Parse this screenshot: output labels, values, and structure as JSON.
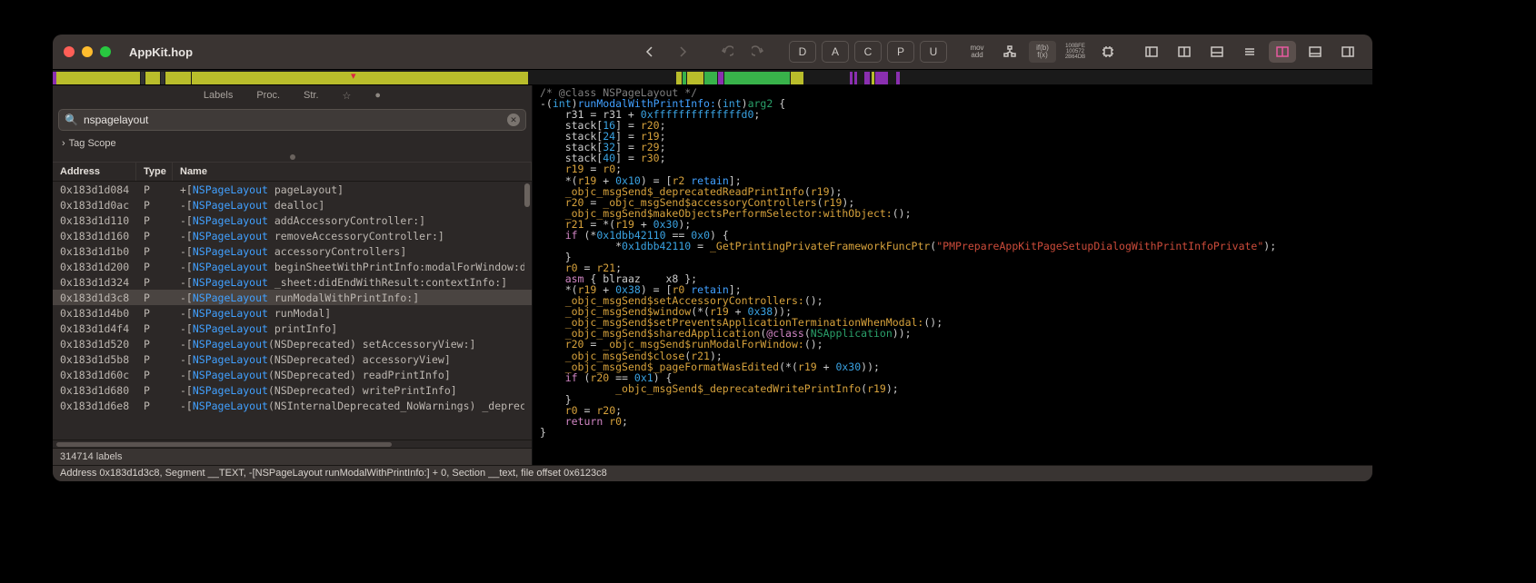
{
  "window": {
    "title": "AppKit.hop"
  },
  "toolbar": {
    "back": "‹",
    "fwd": "›",
    "mode_buttons": [
      "D",
      "A",
      "C",
      "P",
      "U"
    ],
    "mov_add": "mov\nadd",
    "ifb_fx": "if(b)\nf(x)",
    "hex": "100BFE\n100572\n2B64DB"
  },
  "subtabs": {
    "labels": "Labels",
    "proc": "Proc.",
    "str": "Str."
  },
  "search": {
    "value": "nspagelayout",
    "placeholder": ""
  },
  "tagscope": {
    "label": "Tag Scope"
  },
  "table": {
    "headers": {
      "address": "Address",
      "type": "Type",
      "name": "Name"
    },
    "rows": [
      {
        "addr": "0x183d1d084",
        "type": "P",
        "prefix": "+",
        "cls": "NSPageLayout",
        "sel": " pageLayout]",
        "selected": false
      },
      {
        "addr": "0x183d1d0ac",
        "type": "P",
        "prefix": "-",
        "cls": "NSPageLayout",
        "sel": " dealloc]",
        "selected": false
      },
      {
        "addr": "0x183d1d110",
        "type": "P",
        "prefix": "-",
        "cls": "NSPageLayout",
        "sel": " addAccessoryController:]",
        "selected": false
      },
      {
        "addr": "0x183d1d160",
        "type": "P",
        "prefix": "-",
        "cls": "NSPageLayout",
        "sel": " removeAccessoryController:]",
        "selected": false
      },
      {
        "addr": "0x183d1d1b0",
        "type": "P",
        "prefix": "-",
        "cls": "NSPageLayout",
        "sel": " accessoryControllers]",
        "selected": false
      },
      {
        "addr": "0x183d1d200",
        "type": "P",
        "prefix": "-",
        "cls": "NSPageLayout",
        "sel": " beginSheetWithPrintInfo:modalForWindow:delegate:d",
        "selected": false
      },
      {
        "addr": "0x183d1d324",
        "type": "P",
        "prefix": "-",
        "cls": "NSPageLayout",
        "sel": " _sheet:didEndWithResult:contextInfo:]",
        "selected": false
      },
      {
        "addr": "0x183d1d3c8",
        "type": "P",
        "prefix": "-",
        "cls": "NSPageLayout",
        "sel": " runModalWithPrintInfo:]",
        "selected": true
      },
      {
        "addr": "0x183d1d4b0",
        "type": "P",
        "prefix": "-",
        "cls": "NSPageLayout",
        "sel": " runModal]",
        "selected": false
      },
      {
        "addr": "0x183d1d4f4",
        "type": "P",
        "prefix": "-",
        "cls": "NSPageLayout",
        "sel": " printInfo]",
        "selected": false
      },
      {
        "addr": "0x183d1d520",
        "type": "P",
        "prefix": "-",
        "cls": "NSPageLayout",
        "sel": "(NSDeprecated) setAccessoryView:]",
        "selected": false
      },
      {
        "addr": "0x183d1d5b8",
        "type": "P",
        "prefix": "-",
        "cls": "NSPageLayout",
        "sel": "(NSDeprecated) accessoryView]",
        "selected": false
      },
      {
        "addr": "0x183d1d60c",
        "type": "P",
        "prefix": "-",
        "cls": "NSPageLayout",
        "sel": "(NSDeprecated) readPrintInfo]",
        "selected": false
      },
      {
        "addr": "0x183d1d680",
        "type": "P",
        "prefix": "-",
        "cls": "NSPageLayout",
        "sel": "(NSDeprecated) writePrintInfo]",
        "selected": false
      },
      {
        "addr": "0x183d1d6e8",
        "type": "P",
        "prefix": "-",
        "cls": "NSPageLayout",
        "sel": "(NSInternalDeprecated_NoWarnings) _deprecatedReadP",
        "selected": false
      }
    ]
  },
  "label_count": "314714 labels",
  "code": {
    "l00": "/* @class NSPageLayout */",
    "l01a": "-(",
    "l01b": "int",
    "l01c": ")",
    "l01d": "runModalWithPrintInfo:",
    "l01e": "(",
    "l01f": "int",
    "l01g": ")",
    "l01h": "arg2",
    "l01i": " {",
    "l02a": "    r31 = r31 + ",
    "l02b": "0xffffffffffffffd0",
    "l02c": ";",
    "l03a": "    stack[",
    "l03b": "16",
    "l03c": "] = ",
    "l03d": "r20",
    "l03e": ";",
    "l04a": "    stack[",
    "l04b": "24",
    "l04c": "] = ",
    "l04d": "r19",
    "l04e": ";",
    "l05a": "    stack[",
    "l05b": "32",
    "l05c": "] = ",
    "l05d": "r29",
    "l05e": ";",
    "l06a": "    stack[",
    "l06b": "40",
    "l06c": "] = ",
    "l06d": "r30",
    "l06e": ";",
    "l07a": "    ",
    "l07b": "r19",
    "l07c": " = ",
    "l07d": "r0",
    "l07e": ";",
    "l08a": "    *(",
    "l08b": "r19",
    "l08c": " + ",
    "l08d": "0x10",
    "l08e": ") = [",
    "l08f": "r2",
    "l08g": " ",
    "l08h": "retain",
    "l08i": "];",
    "l09a": "    ",
    "l09b": "_objc_msgSend$_deprecatedReadPrintInfo",
    "l09c": "(",
    "l09d": "r19",
    "l09e": ");",
    "l10a": "    ",
    "l10b": "r20",
    "l10c": " = ",
    "l10d": "_objc_msgSend$accessoryControllers",
    "l10e": "(",
    "l10f": "r19",
    "l10g": ");",
    "l11a": "    ",
    "l11b": "_objc_msgSend$makeObjectsPerformSelector:withObject:",
    "l11c": "();",
    "l12a": "    ",
    "l12b": "r21",
    "l12c": " = *(",
    "l12d": "r19",
    "l12e": " + ",
    "l12f": "0x30",
    "l12g": ");",
    "l13a": "    ",
    "l13b": "if",
    "l13c": " (*",
    "l13d": "0x1dbb42110",
    "l13e": " == ",
    "l13f": "0x0",
    "l13g": ") {",
    "l14a": "            *",
    "l14b": "0x1dbb42110",
    "l14c": " = ",
    "l14d": "_GetPrintingPrivateFrameworkFuncPtr",
    "l14e": "(",
    "l14f": "\"PMPrepareAppKitPageSetupDialogWithPrintInfoPrivate\"",
    "l14g": ");",
    "l15": "    }",
    "l16a": "    ",
    "l16b": "r0",
    "l16c": " = ",
    "l16d": "r21",
    "l16e": ";",
    "l17a": "    ",
    "l17b": "asm",
    "l17c": " { blraaz    x8 };",
    "l18a": "    *(",
    "l18b": "r19",
    "l18c": " + ",
    "l18d": "0x38",
    "l18e": ") = [",
    "l18f": "r0",
    "l18g": " ",
    "l18h": "retain",
    "l18i": "];",
    "l19a": "    ",
    "l19b": "_objc_msgSend$setAccessoryControllers:",
    "l19c": "();",
    "l20a": "    ",
    "l20b": "_objc_msgSend$window",
    "l20c": "(*(",
    "l20d": "r19",
    "l20e": " + ",
    "l20f": "0x38",
    "l20g": "));",
    "l21a": "    ",
    "l21b": "_objc_msgSend$setPreventsApplicationTerminationWhenModal:",
    "l21c": "();",
    "l22a": "    ",
    "l22b": "_objc_msgSend$sharedApplication",
    "l22c": "(",
    "l22d": "@class",
    "l22e": "(",
    "l22f": "NSApplication",
    "l22g": "));",
    "l23a": "    ",
    "l23b": "r20",
    "l23c": " = ",
    "l23d": "_objc_msgSend$runModalForWindow:",
    "l23e": "();",
    "l24a": "    ",
    "l24b": "_objc_msgSend$close",
    "l24c": "(",
    "l24d": "r21",
    "l24e": ");",
    "l25a": "    ",
    "l25b": "_objc_msgSend$_pageFormatWasEdited",
    "l25c": "(*(",
    "l25d": "r19",
    "l25e": " + ",
    "l25f": "0x30",
    "l25g": "));",
    "l26a": "    ",
    "l26b": "if",
    "l26c": " (",
    "l26d": "r20",
    "l26e": " == ",
    "l26f": "0x1",
    "l26g": ") {",
    "l27a": "            ",
    "l27b": "_objc_msgSend$_deprecatedWritePrintInfo",
    "l27c": "(",
    "l27d": "r19",
    "l27e": ");",
    "l28": "    }",
    "l29a": "    ",
    "l29b": "r0",
    "l29c": " = ",
    "l29d": "r20",
    "l29e": ";",
    "l30a": "    ",
    "l30b": "return",
    "l30c": " ",
    "l30d": "r0",
    "l30e": ";",
    "l31": "}"
  },
  "status": "Address 0x183d1d3c8, Segment __TEXT, -[NSPageLayout runModalWithPrintInfo:] + 0, Section __text, file offset 0x6123c8"
}
